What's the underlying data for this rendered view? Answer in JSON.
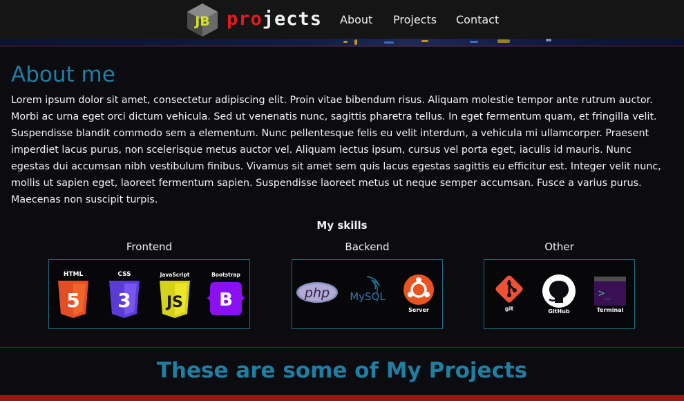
{
  "brand": {
    "logo_initials": "JB",
    "name_part1": "pro",
    "name_part2": "jects"
  },
  "nav": {
    "about": "About",
    "projects": "Projects",
    "contact": "Contact"
  },
  "about": {
    "title": "About me",
    "body": "Lorem ipsum dolor sit amet, consectetur adipiscing elit. Proin vitae bibendum risus. Aliquam molestie tempor ante rutrum auctor. Morbi ac urna eget orci dictum vehicula. Sed ut venenatis nunc, sagittis pharetra tellus. In eget fermentum quam, et fringilla velit. Suspendisse blandit commodo sem a elementum. Nunc pellentesque felis eu velit interdum, a vehicula mi ullamcorper. Praesent imperdiet lacus purus, non scelerisque metus auctor vel. Aliquam lectus ipsum, cursus vel porta eget, iaculis id mauris. Nunc egestas dui accumsan nibh vestibulum finibus. Vivamus sit amet sem quis lacus egestas sagittis eu efficitur est. Integer velit nunc, mollis ut sapien eget, laoreet fermentum sapien. Suspendisse laoreet metus ut neque semper accumsan. Fusce a varius purus. Maecenas non suscipit turpis."
  },
  "skills": {
    "heading": "My skills",
    "frontend": {
      "label": "Frontend",
      "items": [
        "HTML",
        "CSS",
        "JavaScript",
        "Bootstrap"
      ],
      "glyphs": [
        "5",
        "3",
        "JS",
        "B"
      ]
    },
    "backend": {
      "label": "Backend",
      "items": [
        "php",
        "MySQL",
        "Server"
      ]
    },
    "other": {
      "label": "Other",
      "items": [
        "git",
        "GitHub",
        "Terminal"
      ],
      "terminal_prompt": ">_"
    }
  },
  "projects": {
    "title": "These are some of My Projects"
  },
  "colors": {
    "accent_blue": "#1e7fa3",
    "brand_red": "#e5191e",
    "logo_yellow": "#d4e31c",
    "background": "#0c0b10",
    "navbar": "#151515"
  },
  "icons": [
    "logo-cube-icon",
    "html5-icon",
    "css3-icon",
    "javascript-icon",
    "bootstrap-icon",
    "php-icon",
    "mysql-icon",
    "ubuntu-server-icon",
    "git-icon",
    "github-icon",
    "terminal-icon"
  ]
}
